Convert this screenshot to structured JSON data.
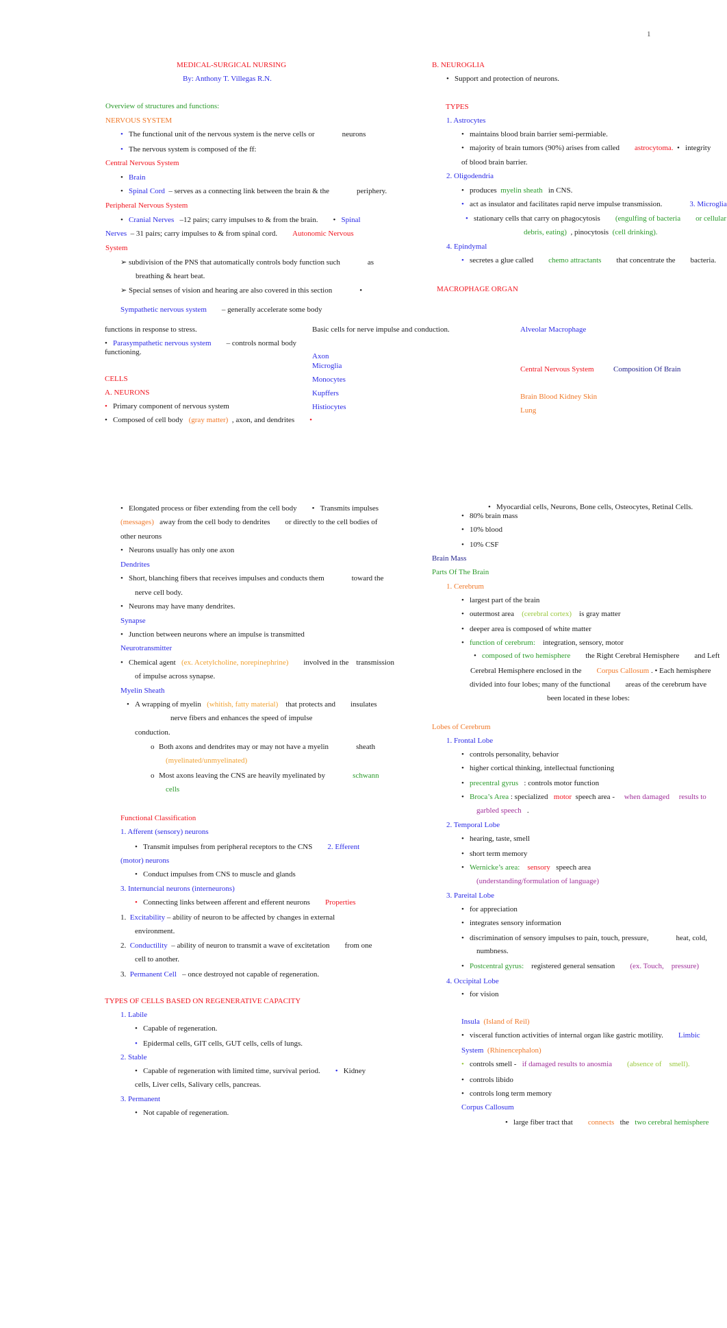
{
  "page_number": "1",
  "header": {
    "title": "MEDICAL-SURGICAL NURSING",
    "author": "By: Anthony T. Villegas R.N."
  },
  "colors": {
    "red": "#f0141e",
    "blue": "#2a2ae6",
    "navy": "#23238c",
    "green": "#2a9a2a",
    "orange": "#f07828",
    "amber": "#f0a030",
    "lime": "#98c83c",
    "purple": "#a0309a",
    "text": "#1a1a1a"
  },
  "bullet": "•",
  "arrow": "➢",
  "circle": "o",
  "left_col_1": {
    "overview": "Overview of structures and functions:",
    "nervous_system": "NERVOUS SYSTEM",
    "ns_b1a": "The functional unit of the nervous system is the nerve cells or",
    "ns_b1b": "neurons",
    "ns_b2": "The nervous system is composed of the ff:",
    "cns": "Central Nervous System",
    "brain": "Brain",
    "spinal_cord": "Spinal Cord",
    "spinal_cord_desc": "– serves as a connecting link between the brain & the",
    "spinal_cord_desc2": "periphery.",
    "pns": "Peripheral Nervous System",
    "cranial": "Cranial Nerves",
    "cranial_desc": "–12 pairs; carry impulses to & from the brain.",
    "spinal_nerves_a": "Spinal",
    "spinal_nerves_b": "Nerves",
    "spinal_nerves_desc": "– 31 pairs; carry impulses to & from spinal cord.",
    "ans_a": "Autonomic Nervous",
    "ans_b": "System",
    "ans_b1a": "subdivision of the PNS that automatically controls body function such",
    "ans_b1b": "as",
    "ans_b1c": "breathing & heart beat.",
    "ans_b2": "Special senses of vision and hearing are also covered in this section",
    "sympathetic": "Sympathetic nervous system",
    "sympathetic_desc": "– generally accelerate some body",
    "sympathetic_desc2": "functions in response to stress.",
    "parasympathetic": "Parasympathetic nervous system",
    "parasympathetic_desc": "– controls normal body",
    "parasympathetic_desc2": "functioning.",
    "cells": "CELLS",
    "neurons": "A. NEURONS",
    "neu_b1": "Primary component of nervous system",
    "neu_b2a": "Composed of cell body",
    "neu_b2b": "(gray matter)",
    "neu_b2c": ", axon, and dendrites"
  },
  "mid_col_1": {
    "basic_cells": "Basic cells for nerve impulse and conduction.",
    "axon": "Axon",
    "microglia": "Microglia",
    "monocytes": "Monocytes",
    "kupffers": "Kupffers",
    "histiocytes": "Histiocytes"
  },
  "right_col_1": {
    "neuroglia": "B. NEUROGLIA",
    "neuroglia_b1": "Support and protection of neurons.",
    "types": "TYPES",
    "astro": "1. Astrocytes",
    "astro_b1": "maintains blood brain barrier semi-permiable.",
    "astro_b2a": "majority of brain tumors (90%) arises from called",
    "astro_b2b": "astrocytoma.",
    "astro_b2c": "integrity",
    "astro_b2d": "of blood brain barrier.",
    "oligo": "2. Oligodendria",
    "oligo_b1a": "produces",
    "oligo_b1b": "myelin sheath",
    "oligo_b1c": "in CNS.",
    "oligo_b2": "act as insulator and facilitates rapid nerve impulse transmission.",
    "micro": "3. Microglia",
    "micro_b1a": "stationary cells that carry on phagocytosis",
    "micro_b1b": "(engulfing of bacteria",
    "micro_b1c": "or cellular",
    "micro_b1d": "debris, eating)",
    "micro_b1e": ", pinocytosis",
    "micro_b1f": "(cell drinking).",
    "epin": "4. Epindymal",
    "epin_b1a": "secretes a glue called",
    "epin_b1b": "chemo attractants",
    "epin_b1c": "that concentrate the",
    "epin_b1d": "bacteria.",
    "macrophage": "MACROPHAGE ORGAN",
    "alveolar": "Alveolar Macrophage",
    "cns": "Central Nervous System",
    "composition": "Composition Of Brain",
    "organs": "Brain Blood Kidney Skin",
    "lung": "Lung"
  },
  "left_col_2": {
    "ax_b1": "Elongated process or fiber extending from the cell body",
    "ax_b2": "Transmits impulses",
    "ax_b2b": "(messages)",
    "ax_b2c": "away from the cell body to dendrites",
    "ax_b2d": "or directly to the cell bodies of",
    "ax_b2e": "other neurons",
    "ax_b3": "Neurons usually has only one axon",
    "dendrites": "Dendrites",
    "den_b1a": "Short, blanching fibers that receives impulses and conducts them",
    "den_b1b": "toward the",
    "den_b1c": "nerve cell body.",
    "den_b2": "Neurons may have many dendrites.",
    "synapse": "Synapse",
    "syn_b1": "Junction between neurons where an impulse is transmitted",
    "neurotransmitter": "Neurotransmitter",
    "nt_b1a": "Chemical agent",
    "nt_b1b": "(ex. Acetylcholine, norepinephrine)",
    "nt_b1c": "involved in the",
    "nt_b1d": "transmission",
    "nt_b1e": "of impulse across synapse.",
    "myelin": "Myelin Sheath",
    "my_b1a": "A wrapping of myelin",
    "my_b1b": "(whitish, fatty material)",
    "my_b1c": "that protects and",
    "my_b1d": "insulates",
    "my_b1e": "nerve fibers and enhances the speed of impulse",
    "my_b1f": "conduction.",
    "my_o1a": "Both axons and dendrites may or may not have a myelin",
    "my_o1b": "sheath",
    "my_o1c": "(myelinated/unmyelinated)",
    "my_o2a": "Most axons leaving the CNS are heavily myelinated by",
    "my_o2b": "schwann",
    "my_o2c": "cells",
    "functional": "Functional Classification",
    "afferent": "1. Afferent (sensory) neurons",
    "aff_b1": "Transmit impulses from peripheral receptors to the CNS",
    "efferent_a": "2. Efferent",
    "efferent_b": "(motor) neurons",
    "eff_b1": "Conduct impulses from CNS to muscle and glands",
    "intern": "3. Internuncial neurons (interneurons)",
    "int_b1": "Connecting links between afferent and efferent neurons",
    "properties": "Properties",
    "p1n": "1.",
    "p1a": "Excitability",
    "p1b": "– ability of neuron to be affected by changes in external",
    "p1c": "environment.",
    "p2n": "2.",
    "p2a": "Conductility",
    "p2b": "– ability of neuron to transmit a wave of excitetation",
    "p2c": "from one",
    "p2d": "cell to another.",
    "p3n": "3.",
    "p3a": "Permanent Cell",
    "p3b": "– once destroyed not capable of regeneration.",
    "types_regen": "TYPES OF CELLS BASED ON REGENERATIVE CAPACITY",
    "labile": "1. Labile",
    "lab_b1": "Capable of regeneration.",
    "lab_b2": "Epidermal cells, GIT cells, GUT cells, cells of lungs.",
    "stable": "2. Stable",
    "st_b1": "Capable of regeneration with limited time, survival period.",
    "st_b2a": "Kidney",
    "st_b2b": "cells, Liver cells, Salivary cells, pancreas.",
    "permanent": "3. Permanent",
    "perm_b1": "Not capable of regeneration."
  },
  "right_col_2": {
    "perm_list": "Myocardial cells, Neurons, Bone cells, Osteocytes, Retinal Cells.",
    "c1": "80% brain mass",
    "c2": "10% blood",
    "c3": "10% CSF",
    "brain_mass": "Brain Mass",
    "parts": "Parts Of The Brain",
    "cerebrum": "1. Cerebrum",
    "ce_b1": "largest part of the brain",
    "ce_b2a": "outermost area",
    "ce_b2b": "(cerebral cortex)",
    "ce_b2c": "is gray matter",
    "ce_b3": "deeper area is composed of white matter",
    "ce_b4a": "function of cerebrum:",
    "ce_b4b": "integration, sensory, motor",
    "ce_b5a": "composed of two hemisphere",
    "ce_b5b": "the Right Cerebral Hemisphere",
    "ce_b5c": "and Left",
    "ce_b5d": "Cerebral Hemisphere enclosed in the",
    "ce_b5e": "Corpus Callosum",
    "ce_b5f": ". •  Each hemisphere",
    "ce_b5g": "divided into four lobes; many of the functional",
    "ce_b5h": "areas of the cerebrum have",
    "ce_b5i": "been located in these lobes:",
    "lobes": "Lobes of Cerebrum",
    "frontal": "1. Frontal Lobe",
    "fr_b1": "controls personality, behavior",
    "fr_b2": "higher cortical thinking, intellectual functioning",
    "fr_b3a": "precentral gyrus",
    "fr_b3b": ": controls motor function",
    "fr_b4a": "Broca’s Area",
    "fr_b4b": ": specialized",
    "fr_b4c": "motor",
    "fr_b4d": "speech area -",
    "fr_b4e": "when damaged",
    "fr_b4f": "results to",
    "fr_b4g": "garbled speech",
    "fr_b4h": ".",
    "temporal": "2. Temporal Lobe",
    "te_b1": "hearing, taste, smell",
    "te_b2": "short term memory",
    "te_b3a": "Wernicke’s area:",
    "te_b3b": "sensory",
    "te_b3c": "speech area",
    "te_b3d": "(understanding/formulation of language)",
    "parietal": "3. Pareital Lobe",
    "pa_b1": "for appreciation",
    "pa_b2": "integrates sensory information",
    "pa_b3a": "discrimination of sensory impulses to pain, touch, pressure,",
    "pa_b3b": "heat, cold,",
    "pa_b3c": "numbness.",
    "pa_b4a": "Postcentral gyrus:",
    "pa_b4b": "registered general sensation",
    "pa_b4c": "(ex. Touch,",
    "pa_b4d": "pressure)",
    "occipital": "4. Occipital Lobe",
    "oc_b1": "for vision",
    "insula": "Insula",
    "insula_b": "(Island of Reil)",
    "in_b1": "visceral function activities of internal organ like gastric motility.",
    "limbic_a": "Limbic",
    "limbic_b": "System",
    "limbic_c": "(Rhinencephalon)",
    "li_b1a": "controls smell -",
    "li_b1b": "if damaged results to anosmia",
    "li_b1c": "(absence of",
    "li_b1d": "smell).",
    "li_b2": "controls libido",
    "li_b3": "controls long term memory",
    "corpus": "Corpus Callosum",
    "co_b1a": "large fiber tract that",
    "co_b1b": "connects",
    "co_b1c": "the",
    "co_b1d": "two cerebral hemisphere"
  }
}
